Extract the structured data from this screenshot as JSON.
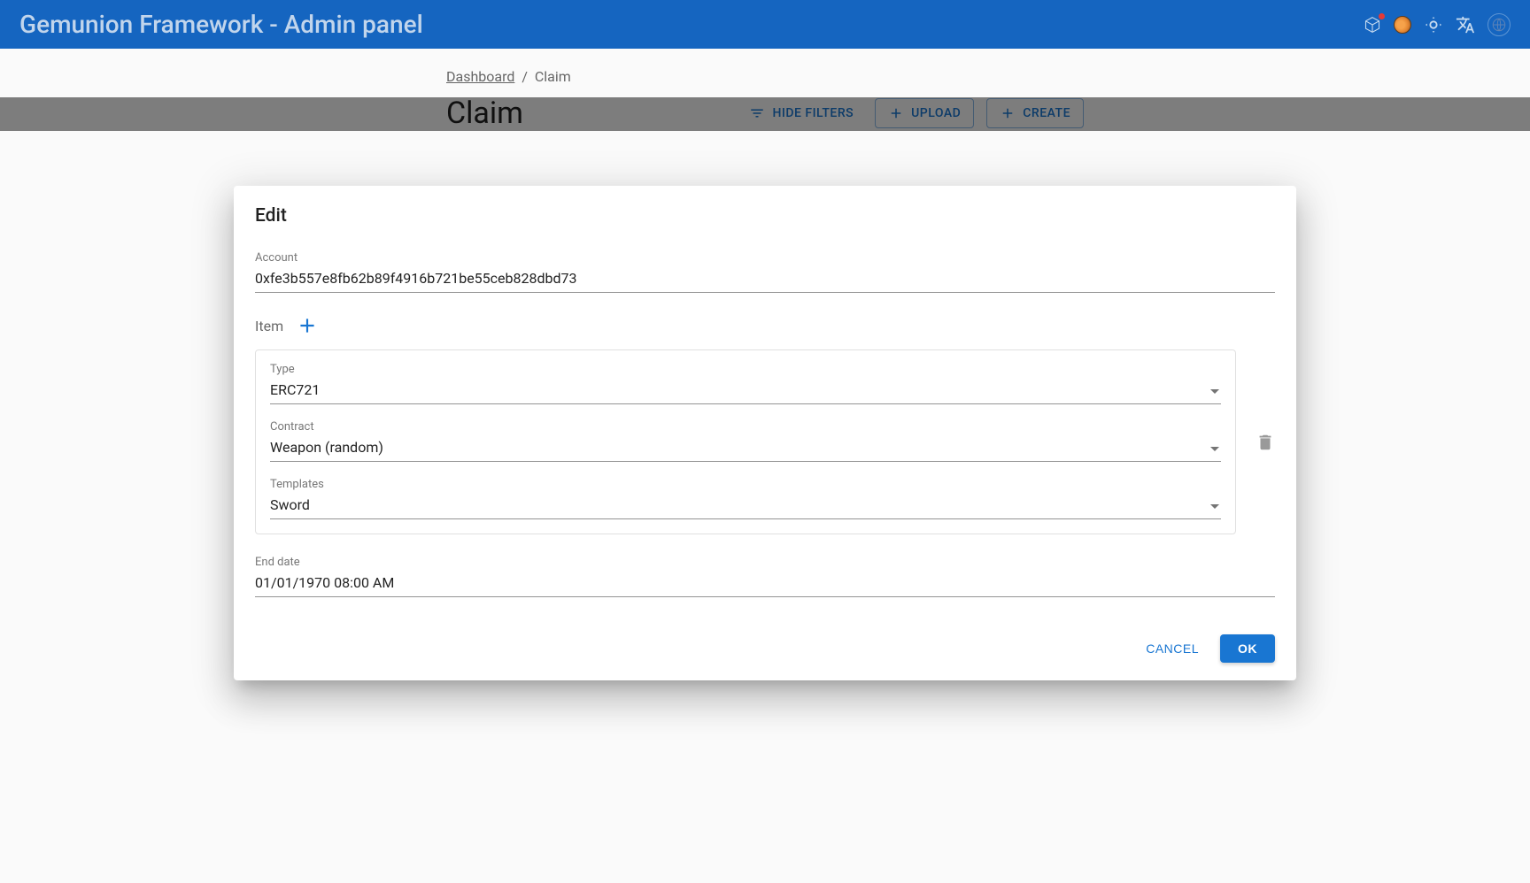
{
  "header": {
    "title": "Gemunion Framework - Admin panel"
  },
  "breadcrumb": {
    "root": "Dashboard",
    "separator": "/",
    "current": "Claim"
  },
  "page": {
    "title": "Claim",
    "hide_filters_label": "HIDE FILTERS",
    "upload_label": "UPLOAD",
    "create_label": "CREATE"
  },
  "modal": {
    "title": "Edit",
    "account_label": "Account",
    "account_value": "0xfe3b557e8fb62b89f4916b721be55ceb828dbd73",
    "item_label": "Item",
    "item_card": {
      "type_label": "Type",
      "type_value": "ERC721",
      "contract_label": "Contract",
      "contract_value": "Weapon (random)",
      "templates_label": "Templates",
      "templates_value": "Sword"
    },
    "end_date_label": "End date",
    "end_date_value": "01/01/1970 08:00 AM",
    "cancel_label": "CANCEL",
    "ok_label": "OK"
  }
}
